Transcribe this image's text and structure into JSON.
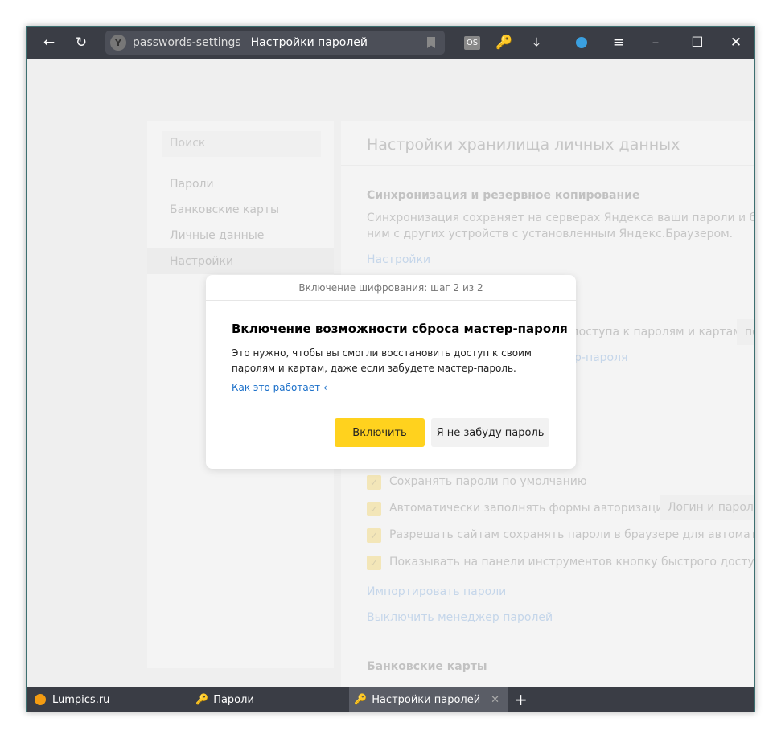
{
  "toolbar": {
    "url": "passwords-settings",
    "page_title": "Настройки паролей",
    "ext_label": "OS"
  },
  "sidebar": {
    "search_placeholder": "Поиск",
    "items": [
      {
        "label": "Пароли"
      },
      {
        "label": "Банковские карты"
      },
      {
        "label": "Личные данные"
      },
      {
        "label": "Настройки"
      }
    ]
  },
  "main": {
    "title": "Настройки хранилища личных данных",
    "sync_heading": "Синхронизация и резервное копирование",
    "sync_text1": "Синхронизация сохраняет на серверах Яндекса ваши пароли и банко",
    "sync_text2": "ним с других устройств с установленным Яндекс.Браузером.",
    "sync_link": "Настройки",
    "access_text": "доступа к паролям и картам",
    "access_select": "по",
    "master_link_partial": "р-пароля",
    "checks": [
      {
        "label": "Сохранять пароли по умолчанию"
      },
      {
        "label": "Автоматически заполнять формы авторизации",
        "select": "Логин и пароль"
      },
      {
        "label": "Разрешать сайтам сохранять пароли в браузере для автоматическ"
      },
      {
        "label": "Показывать на панели инструментов кнопку быстрого доступа к п"
      }
    ],
    "import_link": "Импортировать пароли",
    "disable_link": "Выключить менеджер паролей",
    "cards_heading": "Банковские карты"
  },
  "dialog": {
    "step": "Включение шифрования: шаг 2 из 2",
    "title": "Включение возможности сброса мастер-пароля",
    "text1": "Это нужно, чтобы вы смогли восстановить доступ к своим",
    "text2": "паролям и картам, даже если забудете мастер-пароль.",
    "how_link": "Как это работает",
    "enable": "Включить",
    "decline": "Я не забуду пароль",
    "accent": "#ffd21e"
  },
  "tabs": [
    {
      "label": "Lumpics.ru"
    },
    {
      "label": "Пароли"
    },
    {
      "label": "Настройки паролей",
      "active": true
    }
  ]
}
